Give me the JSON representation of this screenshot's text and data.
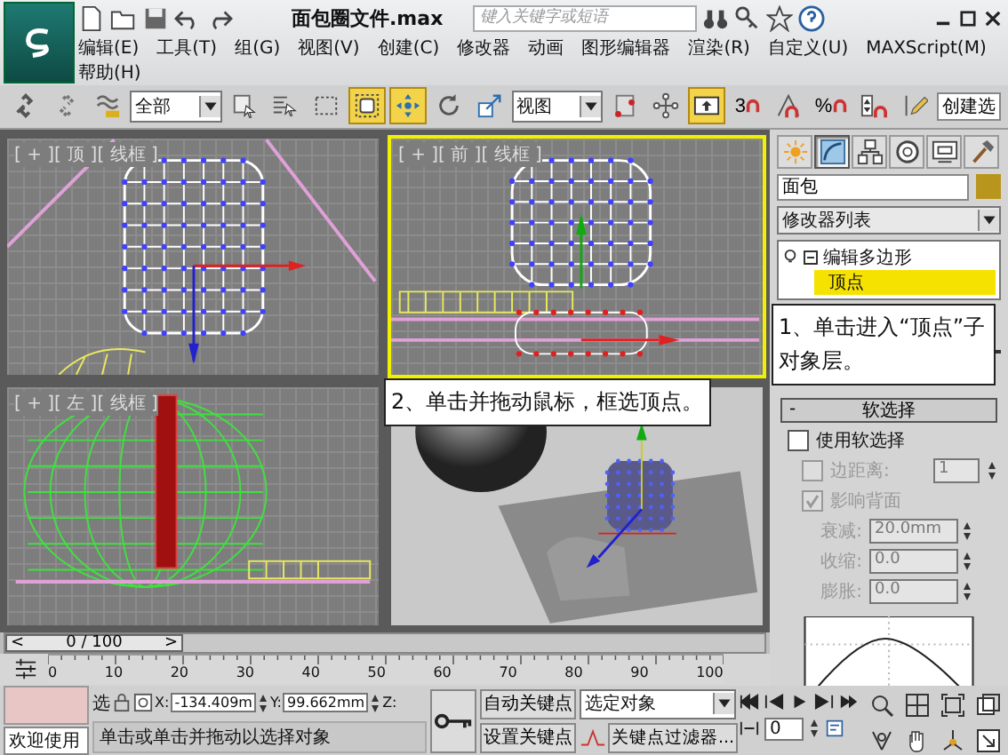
{
  "title_bar": {
    "file_title": "面包圈文件.max",
    "search": {
      "placeholder": "键入关键字或短语"
    }
  },
  "menu_rows": [
    [
      "编辑(E)",
      "工具(T)",
      "组(G)",
      "视图(V)",
      "创建(C)",
      "修改器",
      "动画",
      "图形编辑器",
      "渲染(R)",
      "自定义(U)",
      "MAXScript(M)"
    ],
    [
      "帮助(H)"
    ]
  ],
  "toolbar": [
    {
      "kind": "link",
      "selected": false
    },
    {
      "kind": "unlink",
      "selected": false
    },
    {
      "kind": "bind",
      "selected": false
    },
    {
      "kind": "dropdown",
      "value": "全部"
    },
    {
      "kind": "select-object",
      "selected": false
    },
    {
      "kind": "select-by-name",
      "selected": false
    },
    {
      "kind": "region",
      "selected": false
    },
    {
      "kind": "window-crossing",
      "selected": true
    },
    {
      "kind": "move",
      "selected": true
    },
    {
      "kind": "rotate",
      "selected": false
    },
    {
      "kind": "scale",
      "selected": false
    },
    {
      "kind": "dropdown",
      "value": "视图"
    },
    {
      "kind": "pivot",
      "selected": false
    },
    {
      "kind": "manipulate",
      "selected": false
    },
    {
      "kind": "keyboard",
      "selected": true
    },
    {
      "kind": "snap",
      "label": "3",
      "selected": false
    },
    {
      "kind": "angle-snap",
      "selected": false
    },
    {
      "kind": "percent-snap",
      "label": "%",
      "selected": false
    },
    {
      "kind": "spinner-snap",
      "selected": false
    },
    {
      "kind": "edit-named",
      "selected": false
    },
    {
      "kind": "field",
      "value": "创建选"
    }
  ],
  "viewports": [
    {
      "kind": "top",
      "label": "[ + ][ 顶 ][ 线框 ]",
      "active": false
    },
    {
      "kind": "front",
      "label": "[ + ][ 前 ][ 线框 ]",
      "active": true
    },
    {
      "kind": "left",
      "label": "[ + ][ 左 ][ 线框 ]",
      "active": false
    },
    {
      "kind": "perspective",
      "active": false
    }
  ],
  "callouts": [
    {
      "kind": "panel",
      "text": "1、单击进入“顶点”子对象层。"
    },
    {
      "kind": "viewport",
      "text": "2、单击并拖动鼠标，框选顶点。"
    }
  ],
  "command_panel": {
    "tabs": [
      {
        "kind": "create",
        "selected": false
      },
      {
        "kind": "modify",
        "selected": true
      },
      {
        "kind": "hierarchy",
        "selected": false
      },
      {
        "kind": "motion",
        "selected": false
      },
      {
        "kind": "display",
        "selected": false
      },
      {
        "kind": "utilities",
        "selected": false
      }
    ],
    "object_name": "面包",
    "modifier_list": "修改器列表",
    "stack": [
      {
        "label": "编辑多边形",
        "expanded": true,
        "children": [
          {
            "label": "顶点",
            "selected": true
          }
        ]
      }
    ],
    "soft_selection": {
      "toggle": "-",
      "title": "软选择",
      "expanded": true,
      "options": [
        {
          "label": "使用软选择",
          "checked": false,
          "disabled": false
        },
        {
          "label": "边距离:",
          "checked": false,
          "disabled": true,
          "value": "1"
        },
        {
          "label": "影响背面",
          "checked": true,
          "disabled": true
        }
      ],
      "params": [
        {
          "label": "衰减:",
          "value": "20.0mm",
          "disabled": true
        },
        {
          "label": "收缩:",
          "value": "0.0",
          "disabled": true
        },
        {
          "label": "膨胀:",
          "value": "0.0",
          "disabled": true
        }
      ]
    }
  },
  "time_slider": {
    "prev": "<",
    "position": "0 / 100",
    "next": ">",
    "level": 0
  },
  "track_bar": {
    "ticks": [
      "0",
      "10",
      "20",
      "30",
      "40",
      "50",
      "60",
      "70",
      "80",
      "90",
      "100"
    ]
  },
  "status_bar": {
    "prompt": "欢迎使用",
    "selection_lock": "选",
    "x_label": "X:",
    "x": "-134.409m",
    "y_label": "Y:",
    "y": "99.662mm",
    "z_label": "Z:",
    "message": "单击或单击并拖动以选择对象",
    "auto_key": "自动关键点",
    "set_key": "设置关键点",
    "key_mode": "选定对象",
    "key_filters": "关键点过滤器...",
    "frame": "0"
  }
}
